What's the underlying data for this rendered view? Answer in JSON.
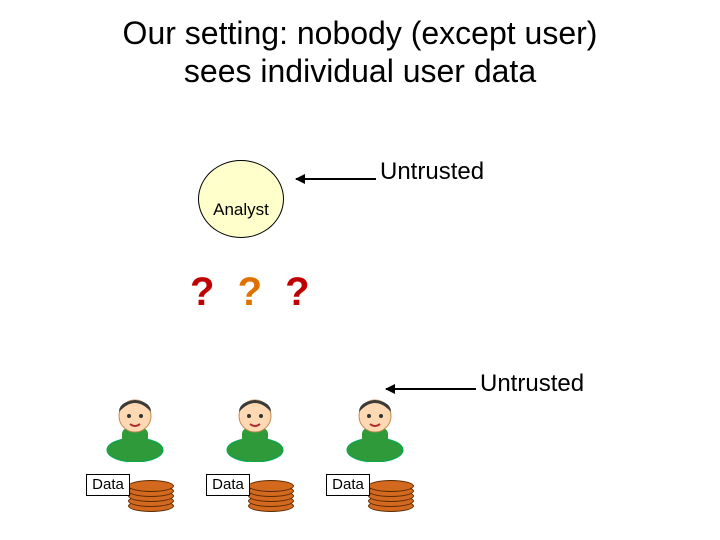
{
  "title_line1": "Our setting: nobody (except user)",
  "title_line2": "sees individual user data",
  "analyst_label": "Analyst",
  "untrusted_label_1": "Untrusted",
  "untrusted_label_2": "Untrusted",
  "question_marks": {
    "q1": "?",
    "q2": "?",
    "q3": "?"
  },
  "users": [
    {
      "data_label": "Data"
    },
    {
      "data_label": "Data"
    },
    {
      "data_label": "Data"
    }
  ]
}
